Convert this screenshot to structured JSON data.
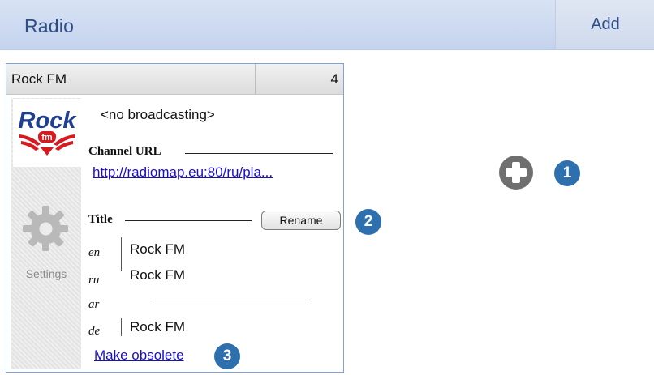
{
  "header": {
    "title": "Radio",
    "add_label": "Add"
  },
  "station": {
    "name": "Rock FM",
    "count": "4",
    "status": "<no broadcasting>",
    "channel_url_label": "Channel URL",
    "channel_url": "http://radiomap.eu:80/ru/pla...",
    "title_label": "Title",
    "rename_label": "Rename",
    "settings_label": "Settings",
    "titles": [
      {
        "lang": "en",
        "value": "Rock FM"
      },
      {
        "lang": "ru",
        "value": "Rock FM"
      },
      {
        "lang": "ar",
        "value": ""
      },
      {
        "lang": "de",
        "value": "Rock FM"
      }
    ],
    "make_obsolete_label": "Make obsolete",
    "logo": {
      "line1": "Rock",
      "line2": "fm",
      "icon": "rockfm-logo"
    }
  },
  "callouts": [
    "1",
    "2",
    "3"
  ],
  "icons": {
    "add": "plus-circle-icon",
    "settings": "gear-icon"
  },
  "colors": {
    "accent": "#2d4e86",
    "callout": "#2e6fae",
    "link": "#1a0dcc",
    "logo_red": "#d71920",
    "logo_blue": "#1f3f91"
  }
}
